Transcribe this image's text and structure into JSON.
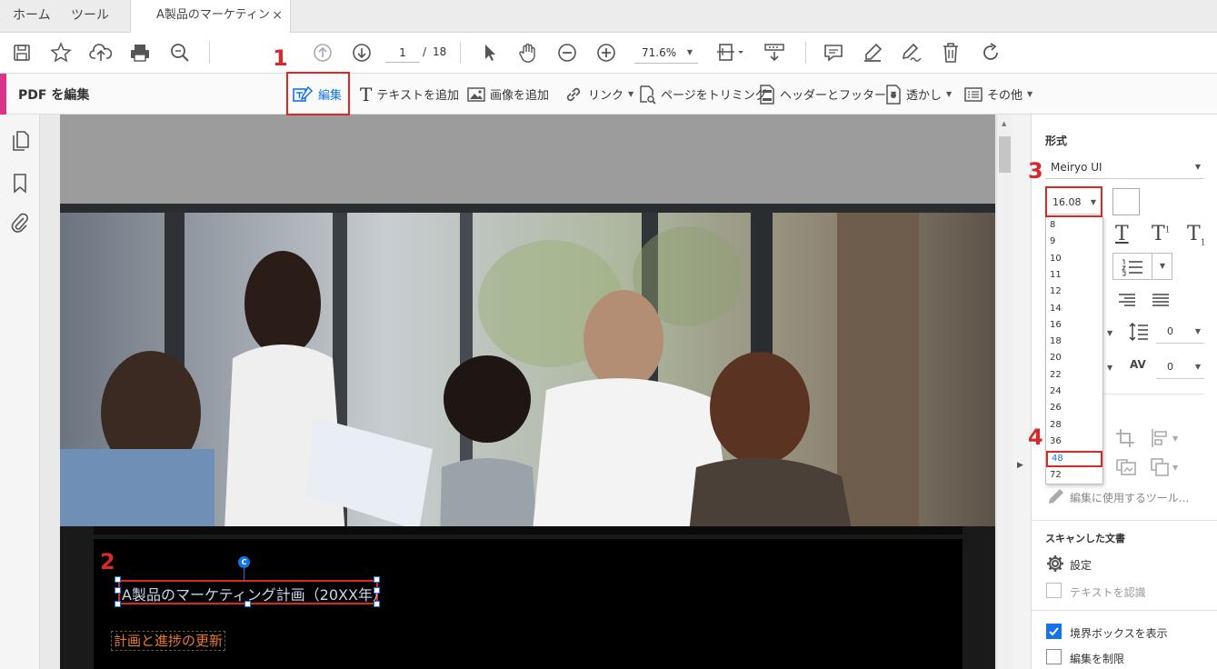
{
  "tabs": {
    "home": "ホーム",
    "tools": "ツール",
    "document": "A製品のマーケティング...",
    "close": "×"
  },
  "toolbar": {
    "page_current": "1",
    "page_sep": "/",
    "page_total": "18",
    "zoom": "71.6%"
  },
  "editbar": {
    "title": "PDF を編集",
    "edit": "編集",
    "add_text": "テキストを追加",
    "add_image": "画像を追加",
    "link": "リンク",
    "crop": "ページをトリミング",
    "header_footer": "ヘッダーとフッター",
    "watermark": "透かし",
    "more": "その他"
  },
  "document": {
    "title_text": "A製品のマーケティング計画（20XX年）",
    "subtitle_text": "計画と進捗の更新",
    "handle_label": "C"
  },
  "panel": {
    "format_heading": "形式",
    "font_name": "Meiryo UI",
    "font_size": "16.08",
    "font_size_options": [
      "8",
      "9",
      "10",
      "11",
      "12",
      "14",
      "16",
      "18",
      "20",
      "22",
      "24",
      "26",
      "28",
      "36",
      "48",
      "72"
    ],
    "highlighted_option": "48",
    "line_spacing_value": "0",
    "char_spacing_value": "0",
    "edit_tools_label": "編集に使用するツール...",
    "scanned_heading": "スキャンした文書",
    "settings_label": "設定",
    "recognize_text": "テキストを認識",
    "show_bbox": "境界ボックスを表示",
    "restrict_edit": "編集を制限"
  },
  "steps": {
    "s1": "1",
    "s2": "2",
    "s3": "3",
    "s4": "4"
  },
  "colors": {
    "accent": "#1473e6",
    "annotation_red": "#e02525",
    "pink_marker": "#d9348a"
  }
}
